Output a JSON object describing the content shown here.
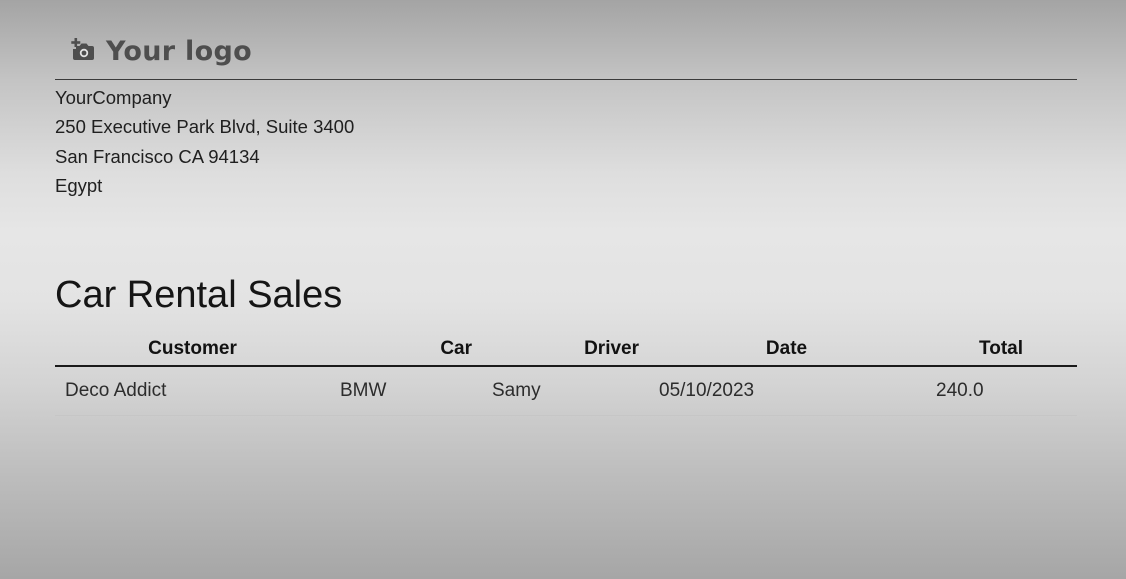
{
  "logo": {
    "icon": "camera-plus-icon",
    "text": "Your logo"
  },
  "company": {
    "name": "YourCompany",
    "street": "250 Executive Park Blvd, Suite 3400",
    "city_line": "San Francisco CA 94134",
    "country": "Egypt"
  },
  "report": {
    "title": "Car Rental Sales",
    "headers": {
      "customer": "Customer",
      "car": "Car",
      "driver": "Driver",
      "date": "Date",
      "total": "Total"
    },
    "rows": [
      {
        "customer": "Deco Addict",
        "car": "BMW",
        "driver": "Samy",
        "date": "05/10/2023",
        "total": "240.0"
      }
    ]
  }
}
